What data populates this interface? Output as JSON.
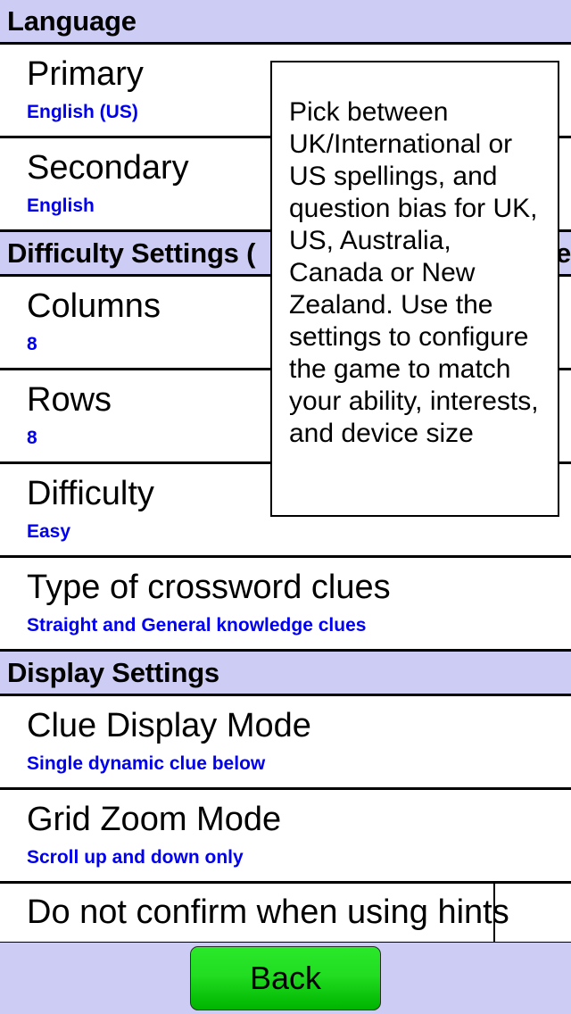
{
  "app": {
    "screen_title": "Settings"
  },
  "sections": [
    {
      "header": "Language",
      "rows": [
        {
          "label": "Primary",
          "value": "English (US)",
          "type": "pair"
        },
        {
          "label": "Secondary",
          "value": "English",
          "type": "pair"
        }
      ]
    },
    {
      "header": "Difficulty Settings (",
      "header_tail": "e",
      "rows": [
        {
          "label": "Columns",
          "value": "8",
          "type": "pair"
        },
        {
          "label": "Rows",
          "value": "8",
          "type": "pair"
        },
        {
          "label": "Difficulty",
          "value": "Easy",
          "type": "pair"
        },
        {
          "label": "Type of crossword clues",
          "value": "Straight and General knowledge clues",
          "type": "pair"
        }
      ]
    },
    {
      "header": "Display Settings",
      "rows": [
        {
          "label": "Clue Display Mode",
          "value": "Single dynamic clue below",
          "type": "pair"
        },
        {
          "label": "Grid Zoom Mode",
          "value": "Scroll up and down only",
          "type": "pair"
        },
        {
          "label": "Do not confirm when using hints",
          "value": "",
          "type": "checkbox",
          "checked": false
        }
      ]
    }
  ],
  "tooltip": {
    "text": "Pick between UK/International or US spellings, and question bias for UK, US, Australia, Canada or New Zealand. Use the settings to configure the game to match your ability, interests, and device size"
  },
  "bottom_bar": {
    "back_label": "Back"
  },
  "colors": {
    "section_header_bg": "#ccccf5",
    "bottom_bar_bg": "#ccccf5",
    "value_text": "#0000ee",
    "label_text": "#000000",
    "button_green_top": "#2ae82a",
    "button_green_bottom": "#00b400"
  }
}
